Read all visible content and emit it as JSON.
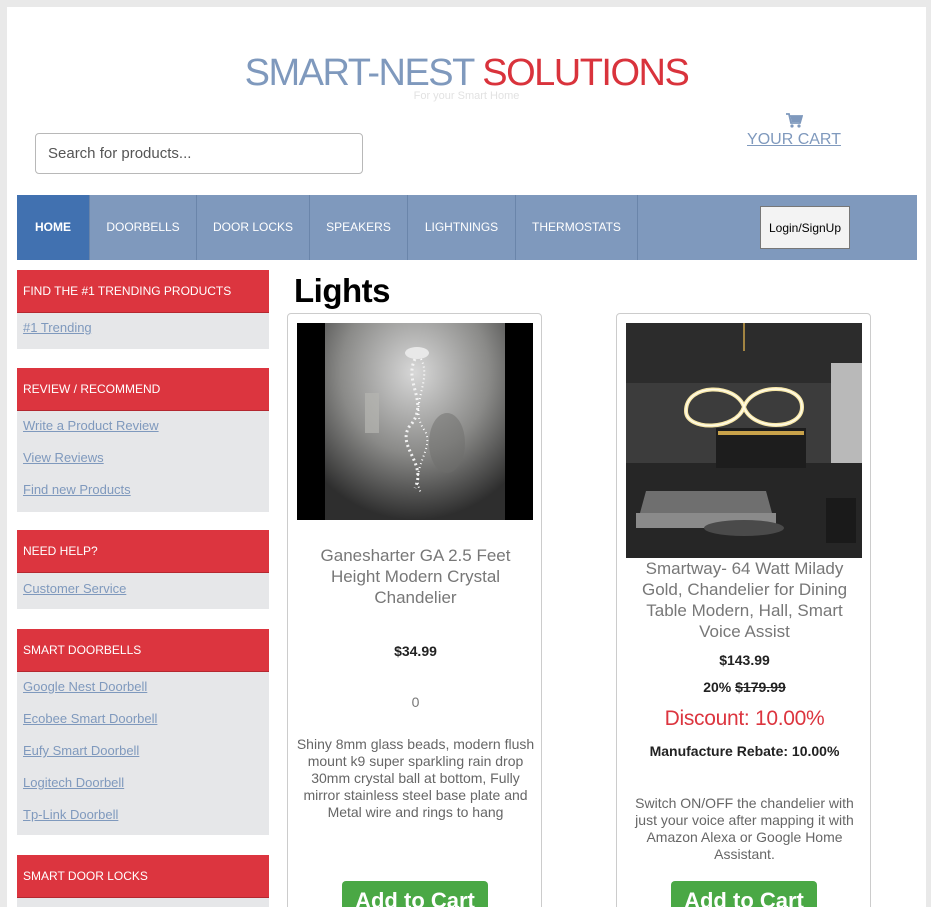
{
  "brand": {
    "part1": "SMART-NEST",
    "part2": "SOLUTIONS",
    "tagline": "For your Smart Home"
  },
  "search": {
    "placeholder": "Search for products..."
  },
  "cart": {
    "label": "YOUR CART",
    "icon": "cart-icon"
  },
  "nav": {
    "items": [
      "HOME",
      "DOORBELLS",
      "DOOR LOCKS",
      "SPEAKERS",
      "LIGHTNINGS",
      "THERMOSTATS"
    ],
    "login_label": "Login/SignUp"
  },
  "sidebar": {
    "sections": [
      {
        "title": "FIND THE #1 TRENDING PRODUCTS",
        "links": [
          "#1 Trending"
        ]
      },
      {
        "title": "REVIEW / RECOMMEND",
        "links": [
          "Write a Product Review",
          "View Reviews",
          "Find new Products"
        ]
      },
      {
        "title": "NEED HELP?",
        "links": [
          "Customer Service"
        ]
      },
      {
        "title": "SMART DOORBELLS",
        "links": [
          "Google Nest Doorbell",
          "Ecobee Smart Doorbell",
          "Eufy Smart Doorbell",
          "Logitech Doorbell",
          "Tp-Link Doorbell"
        ]
      },
      {
        "title": "SMART DOOR LOCKS",
        "links": []
      }
    ]
  },
  "main": {
    "heading": "Lights",
    "products": [
      {
        "name": "Ganesharter GA 2.5 Feet Height Modern Crystal Chandelier",
        "price": "$34.99",
        "count": "0",
        "description": "Shiny 8mm glass beads, modern flush mount k9 super sparkling rain drop 30mm crystal ball at bottom, Fully mirror stainless steel base plate and Metal wire and rings to hang",
        "button": "Add to Cart"
      },
      {
        "name": "Smartway- 64 Watt Milady Gold, Chandelier for Dining Table Modern, Hall, Smart Voice Assist",
        "price": "$143.99",
        "discount_pct": "20%",
        "old_price": "$179.99",
        "discount_label": "Discount: 10.00%",
        "rebate_label": "Manufacture Rebate: 10.00%",
        "description": "Switch ON/OFF the chandelier with just your voice after mapping it with Amazon Alexa or Google Home Assistant.",
        "button": "Add to Cart"
      }
    ]
  },
  "colors": {
    "brand_blue": "#7f99bd",
    "brand_red": "#d9333c",
    "nav_active": "#4171b0",
    "sidebar_head": "#dc353f",
    "add_button": "#4aa845"
  }
}
